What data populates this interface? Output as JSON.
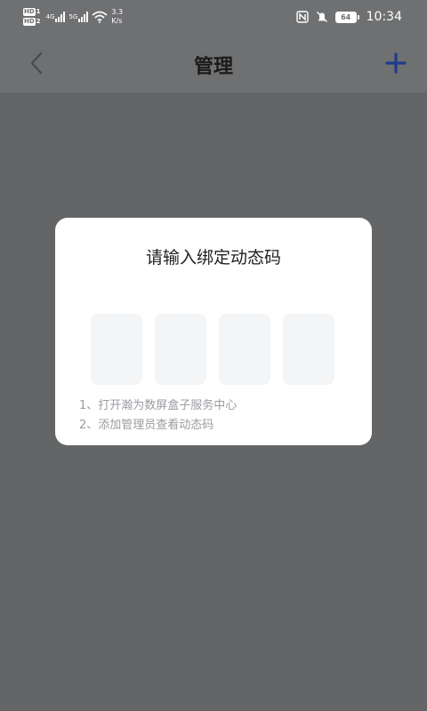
{
  "status_bar": {
    "hd1": "HD",
    "hd1_sub": "1",
    "hd2": "HD",
    "hd2_sub": "2",
    "net1": "4G",
    "net2": "5G",
    "speed_value": "3.3",
    "speed_unit": "K/s",
    "battery": "64",
    "time": "10:34",
    "icons": [
      "nfc-icon",
      "mute-icon",
      "wifi-icon",
      "battery-icon"
    ]
  },
  "header": {
    "title": "管理",
    "back_icon": "chevron-left-icon",
    "add_icon": "plus-icon",
    "accent_color": "#1f3c88"
  },
  "modal": {
    "title": "请输入绑定动态码",
    "code_inputs": [
      "",
      "",
      "",
      ""
    ],
    "instructions": [
      "1、打开瀚为数屏盒子服务中心",
      "2、添加管理员查看动态码"
    ]
  }
}
